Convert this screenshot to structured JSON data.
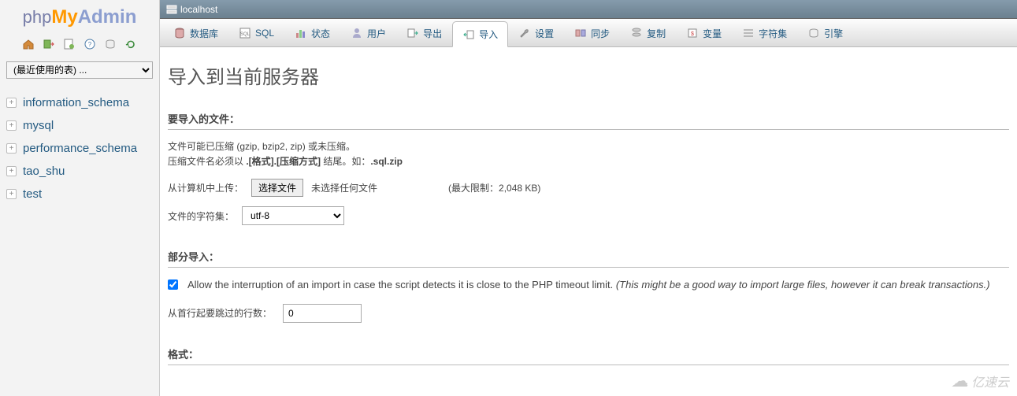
{
  "logo": {
    "php": "php",
    "my": "My",
    "admin": "Admin"
  },
  "sidebar": {
    "recent_label": "(最近使用的表) ...",
    "databases": [
      {
        "name": "information_schema"
      },
      {
        "name": "mysql"
      },
      {
        "name": "performance_schema"
      },
      {
        "name": "tao_shu"
      },
      {
        "name": "test"
      }
    ]
  },
  "breadcrumb": {
    "server": "localhost"
  },
  "tabs": [
    {
      "id": "databases",
      "label": "数据库"
    },
    {
      "id": "sql",
      "label": "SQL"
    },
    {
      "id": "status",
      "label": "状态"
    },
    {
      "id": "users",
      "label": "用户"
    },
    {
      "id": "export",
      "label": "导出"
    },
    {
      "id": "import",
      "label": "导入",
      "active": true
    },
    {
      "id": "settings",
      "label": "设置"
    },
    {
      "id": "sync",
      "label": "同步"
    },
    {
      "id": "replication",
      "label": "复制"
    },
    {
      "id": "variables",
      "label": "变量"
    },
    {
      "id": "charsets",
      "label": "字符集"
    },
    {
      "id": "engines",
      "label": "引擎"
    }
  ],
  "page": {
    "title": "导入到当前服务器",
    "file_to_import_legend": "要导入的文件：",
    "compression_hint1": "文件可能已压缩 (gzip, bzip2, zip) 或未压缩。",
    "compression_hint2_pre": "压缩文件名必须以 ",
    "compression_hint2_bold1": ".[格式].[压缩方式]",
    "compression_hint2_mid": " 结尾。如：",
    "compression_hint2_bold2": ".sql.zip",
    "upload_label": "从计算机中上传：",
    "choose_file_btn": "选择文件",
    "no_file_selected": "未选择任何文件",
    "max_size": "(最大限制：2,048 KB)",
    "charset_label": "文件的字符集：",
    "charset_value": "utf-8",
    "partial_legend": "部分导入：",
    "allow_interrupt_text": "Allow the interruption of an import in case the script detects it is close to the PHP timeout limit. ",
    "allow_interrupt_em": "(This might be a good way to import large files, however it can break transactions.)",
    "allow_interrupt_checked": true,
    "skip_rows_label": "从首行起要跳过的行数：",
    "skip_rows_value": "0",
    "format_legend": "格式："
  },
  "watermark": "亿速云"
}
